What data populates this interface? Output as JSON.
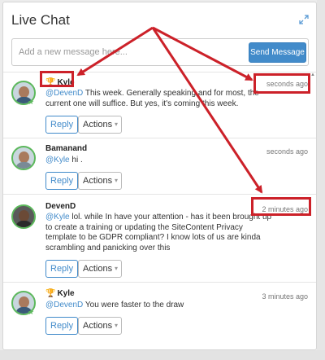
{
  "chat": {
    "title": "Live Chat",
    "expand_icon": "expand-icon",
    "compose": {
      "placeholder": "Add a new message here...",
      "value": "",
      "send_label": "Send Message"
    },
    "messages": [
      {
        "author": "Kyle",
        "trophy": true,
        "mention": "@DevenD",
        "body": " This week. Generally speaking and for most, the current one will suffice. But yes, it's coming this week.",
        "time": "seconds ago",
        "reply_label": "Reply",
        "actions_label": "Actions"
      },
      {
        "author": "Bamanand",
        "trophy": false,
        "mention": "@Kyle",
        "body": " hi .",
        "time": "seconds ago",
        "reply_label": "Reply",
        "actions_label": "Actions"
      },
      {
        "author": "DevenD",
        "trophy": false,
        "mention": "@Kyle",
        "body": " lol. while In have your attention - has it been brought up to create a training or updating the SiteContent Privacy template to be GDPR compliant? I know lots of us are kinda scrambling and panicking over this",
        "time": "2 minutes ago",
        "reply_label": "Reply",
        "actions_label": "Actions"
      },
      {
        "author": "Kyle",
        "trophy": true,
        "mention": "@DevenD",
        "body": " You were faster to the draw",
        "time": "3 minutes ago",
        "reply_label": "Reply",
        "actions_label": "Actions"
      }
    ]
  },
  "colors": {
    "accent": "#428bca",
    "annotation": "#cc2129",
    "online": "#5cb85c"
  }
}
